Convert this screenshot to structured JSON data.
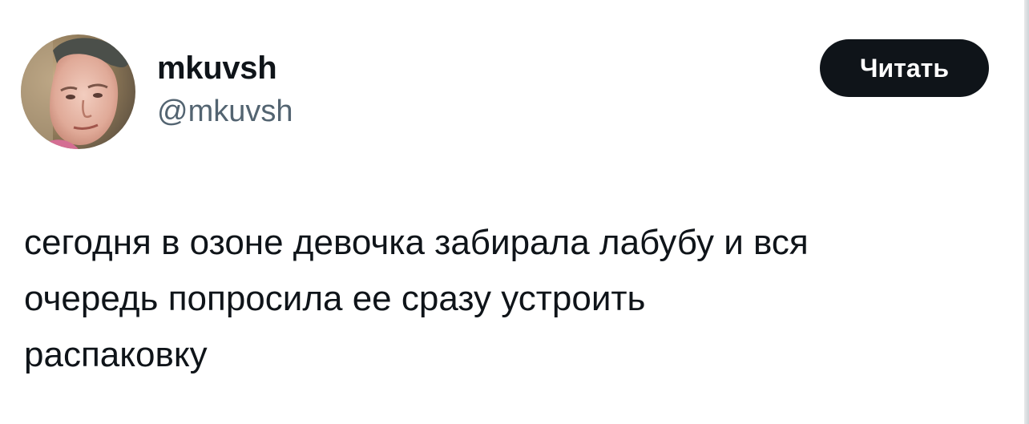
{
  "author": {
    "display_name": "mkuvsh",
    "handle": "@mkuvsh",
    "avatar_icon": "user-avatar-photo"
  },
  "actions": {
    "follow_label": "Читать"
  },
  "tweet": {
    "text": "сегодня в озоне девочка забирала лабубу и вся\nочередь попросила ее сразу устроить\nраспаковку"
  },
  "colors": {
    "text_primary": "#0f1419",
    "text_secondary": "#536471",
    "button_bg": "#0f1419",
    "button_text": "#ffffff",
    "background": "#ffffff"
  }
}
